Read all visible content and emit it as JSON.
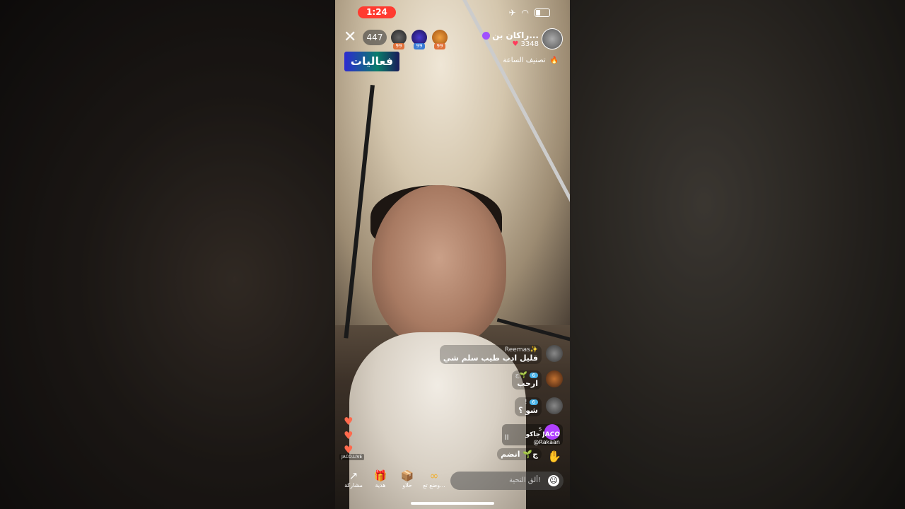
{
  "status_bar": {
    "time": "1:24"
  },
  "header": {
    "viewer_count": "447",
    "activities_banner": "فعاليات",
    "top_gifters": [
      {
        "badge": "99",
        "color": "#e0713a"
      },
      {
        "badge": "99",
        "color": "#3a7bd5"
      },
      {
        "badge": "99",
        "color": "#e0713a"
      }
    ]
  },
  "host": {
    "name": "راكان بن...",
    "likes": "3348"
  },
  "hour_ranking": {
    "label": "تصنيف الساعة"
  },
  "comments": [
    {
      "user": "Reemas✨",
      "text": "قليل ادب طيب سلم شي"
    },
    {
      "user": "ج🌱",
      "level": "6",
      "text": "ارحب"
    },
    {
      "user": "!",
      "level": "6",
      "text": "شو ؟"
    },
    {
      "user": "ج🌱",
      "text": "انضم"
    }
  ],
  "jaco_panel": {
    "user": "جاكو JACO",
    "handle": "@Rakaan",
    "letter": "s"
  },
  "watermark": "JACO.LIVE",
  "comment_input": {
    "placeholder": "ألق التحية!"
  },
  "toolbar": [
    {
      "label": "مشاركة",
      "icon": "share-icon",
      "glyph": "↗"
    },
    {
      "label": "هدية",
      "icon": "gift-icon",
      "glyph": "🎁"
    },
    {
      "label": "حلاو",
      "icon": "box-icon",
      "glyph": "📦"
    },
    {
      "label": "وضع تع...",
      "icon": "link-icon",
      "glyph": "∞"
    }
  ]
}
